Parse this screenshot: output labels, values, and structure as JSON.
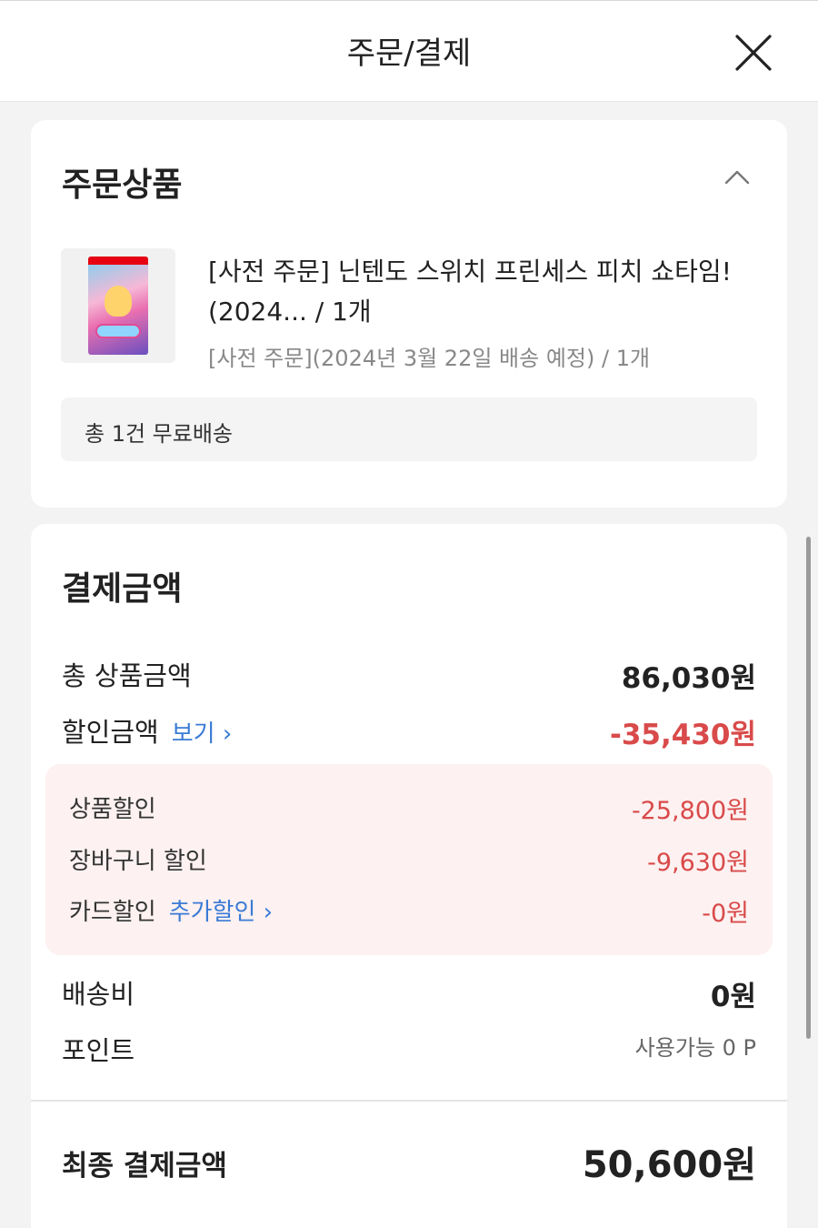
{
  "header": {
    "title": "주문/결제",
    "close_icon": "close-icon"
  },
  "order_section": {
    "title": "주문상품",
    "collapse_icon": "chevron-up-icon",
    "item": {
      "name_line1": "[사전 주문] 닌텐도 스위치 프린세스 피치 쇼타임!",
      "name_line2": "(2024... / 1개",
      "option": "[사전 주문](2024년 3월 22일 배송 예정)   / 1개"
    },
    "shipping_summary": "총 1건 무료배송"
  },
  "payment_section": {
    "title": "결제금액",
    "total_label": "총 상품금액",
    "total_value": "86,030원",
    "discount_label": "할인금액",
    "discount_link": "보기 ›",
    "discount_value": "-35,430원",
    "discounts": [
      {
        "label": "상품할인",
        "value": "-25,800원"
      },
      {
        "label": "장바구니 할인",
        "value": "-9,630원"
      },
      {
        "label": "카드할인",
        "link": "추가할인 ›",
        "value": "-0원"
      }
    ],
    "shipping_label": "배송비",
    "shipping_value": "0원",
    "points_label": "포인트",
    "points_value": "사용가능 0 P",
    "final_label": "최종 결제금액",
    "final_value": "50,600원"
  },
  "colors": {
    "discount_red": "#d94a4a",
    "link_blue": "#3a7bd5",
    "discount_bg": "#fdf1f1"
  }
}
